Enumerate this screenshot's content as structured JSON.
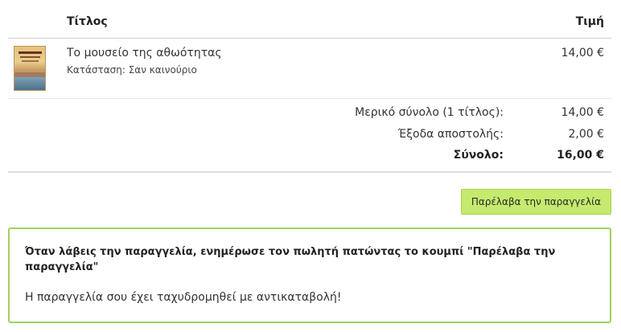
{
  "table": {
    "title_header": "Τίτλος",
    "price_header": "Τιμή"
  },
  "item": {
    "cover_icon": "book-cover-image",
    "title": "Το μουσείο της αθωότητας",
    "condition": "Κατάσταση: Σαν καινούριο",
    "price": "14,00 €"
  },
  "totals": {
    "subtotal_label": "Μερικό σύνολο (1 τίτλος):",
    "subtotal_value": "14,00 €",
    "shipping_label": "Έξοδα αποστολής:",
    "shipping_value": "2,00 €",
    "total_label": "Σύνολο:",
    "total_value": "16,00 €"
  },
  "actions": {
    "received_label": "Παρέλαβα την παραγγελία"
  },
  "notice": {
    "instruction": "Όταν λάβεις την παραγγελία, ενημέρωσε τον πωλητή πατώντας το κουμπί \"Παρέλαβα την παραγγελία\"",
    "status": "Η παραγγελία σου έχει ταχυδρομηθεί με αντικαταβολή!"
  },
  "colors": {
    "button_bg": "#c5ea6e",
    "notice_border": "#9ed45a"
  }
}
